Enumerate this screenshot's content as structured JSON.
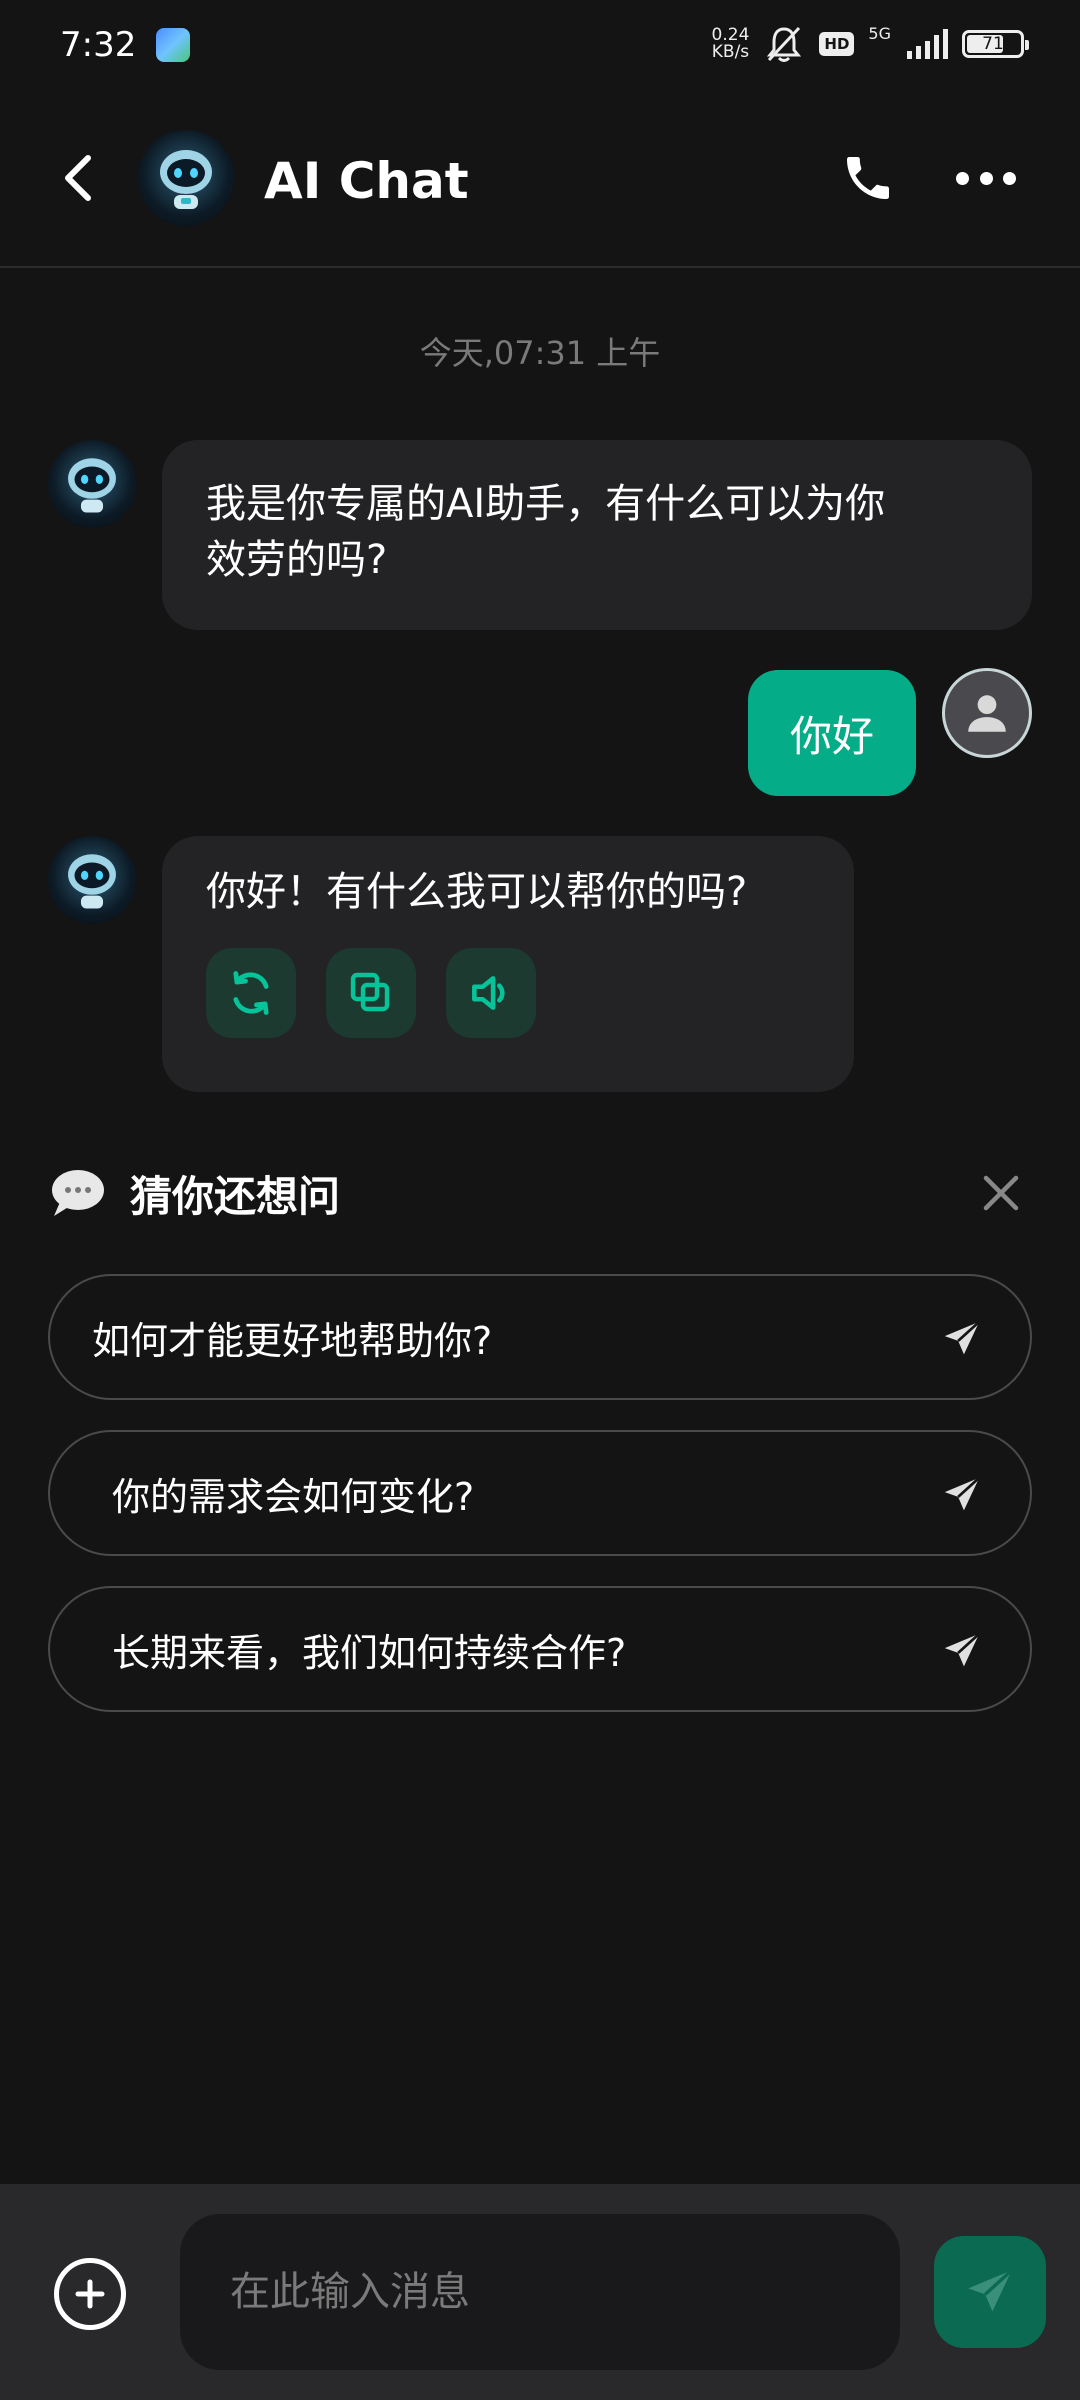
{
  "status_bar": {
    "time": "7:32",
    "net_speed_value": "0.24",
    "net_speed_unit": "KB/s",
    "hd": "HD",
    "network": "5G",
    "battery": "71",
    "battery_level_pct": 71
  },
  "header": {
    "title": "AI Chat"
  },
  "chat": {
    "timestamp": "今天,07:31 上午",
    "messages": [
      {
        "role": "assistant",
        "text_line1": "我是你专属的AI助手，有什么可以为你",
        "text_line2": "效劳的吗?"
      },
      {
        "role": "user",
        "text": "你好"
      },
      {
        "role": "assistant",
        "text": "你好！有什么我可以帮你的吗?"
      }
    ]
  },
  "suggestions": {
    "title": "猜你还想问",
    "items": [
      "如何才能更好地帮助你?",
      "你的需求会如何变化?",
      "长期来看，我们如何持续合作?"
    ]
  },
  "composer": {
    "placeholder": "在此输入消息"
  },
  "colors": {
    "background": "#141414",
    "accent": "#04ad87",
    "bubble_ai": "#232325",
    "action_bg": "#1c3a30",
    "send_bg": "#0a6b52"
  },
  "icons": {
    "back": "chevron-left-icon",
    "call": "phone-icon",
    "more": "more-icon",
    "regenerate": "refresh-icon",
    "copy": "copy-icon",
    "speak": "speaker-icon",
    "chat": "chat-bubble-icon",
    "close": "close-icon",
    "send": "send-icon",
    "add": "plus-icon"
  }
}
